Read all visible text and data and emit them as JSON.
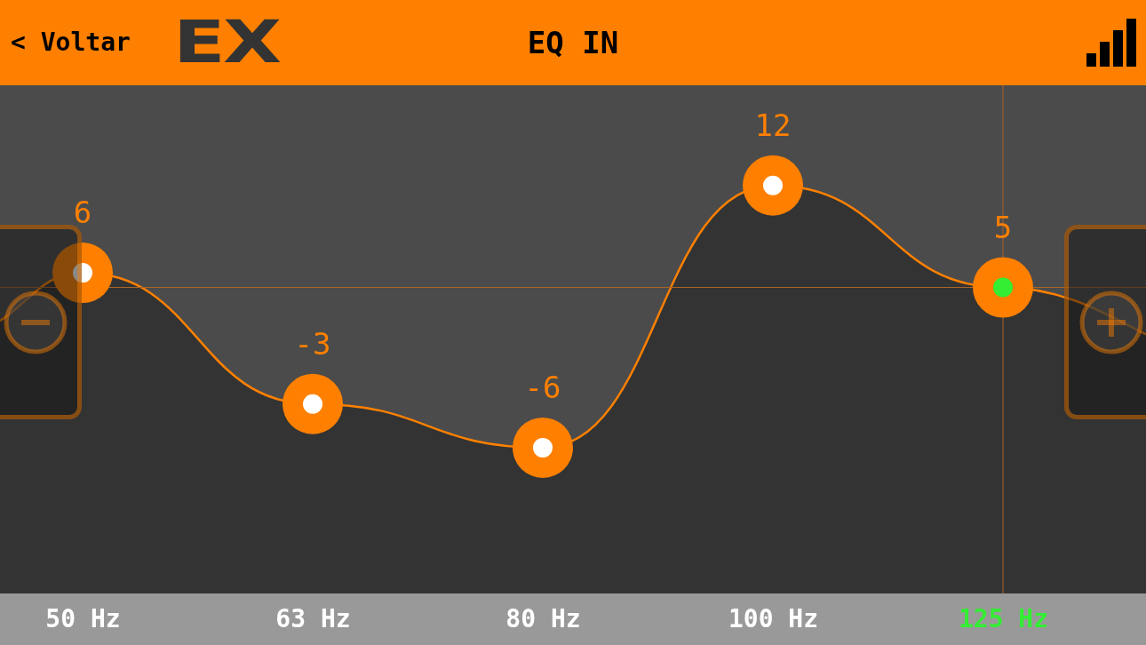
{
  "header": {
    "back": "< Voltar",
    "logo": "EX",
    "title": "EQ IN"
  },
  "eq": {
    "bands": [
      {
        "frequency": "50 Hz",
        "value": "6",
        "selected": false
      },
      {
        "frequency": "63 Hz",
        "value": "-3",
        "selected": false
      },
      {
        "frequency": "80 Hz",
        "value": "-6",
        "selected": false
      },
      {
        "frequency": "100 Hz",
        "value": "12",
        "selected": false
      },
      {
        "frequency": "125 Hz",
        "value": "5",
        "selected": true
      }
    ]
  }
}
